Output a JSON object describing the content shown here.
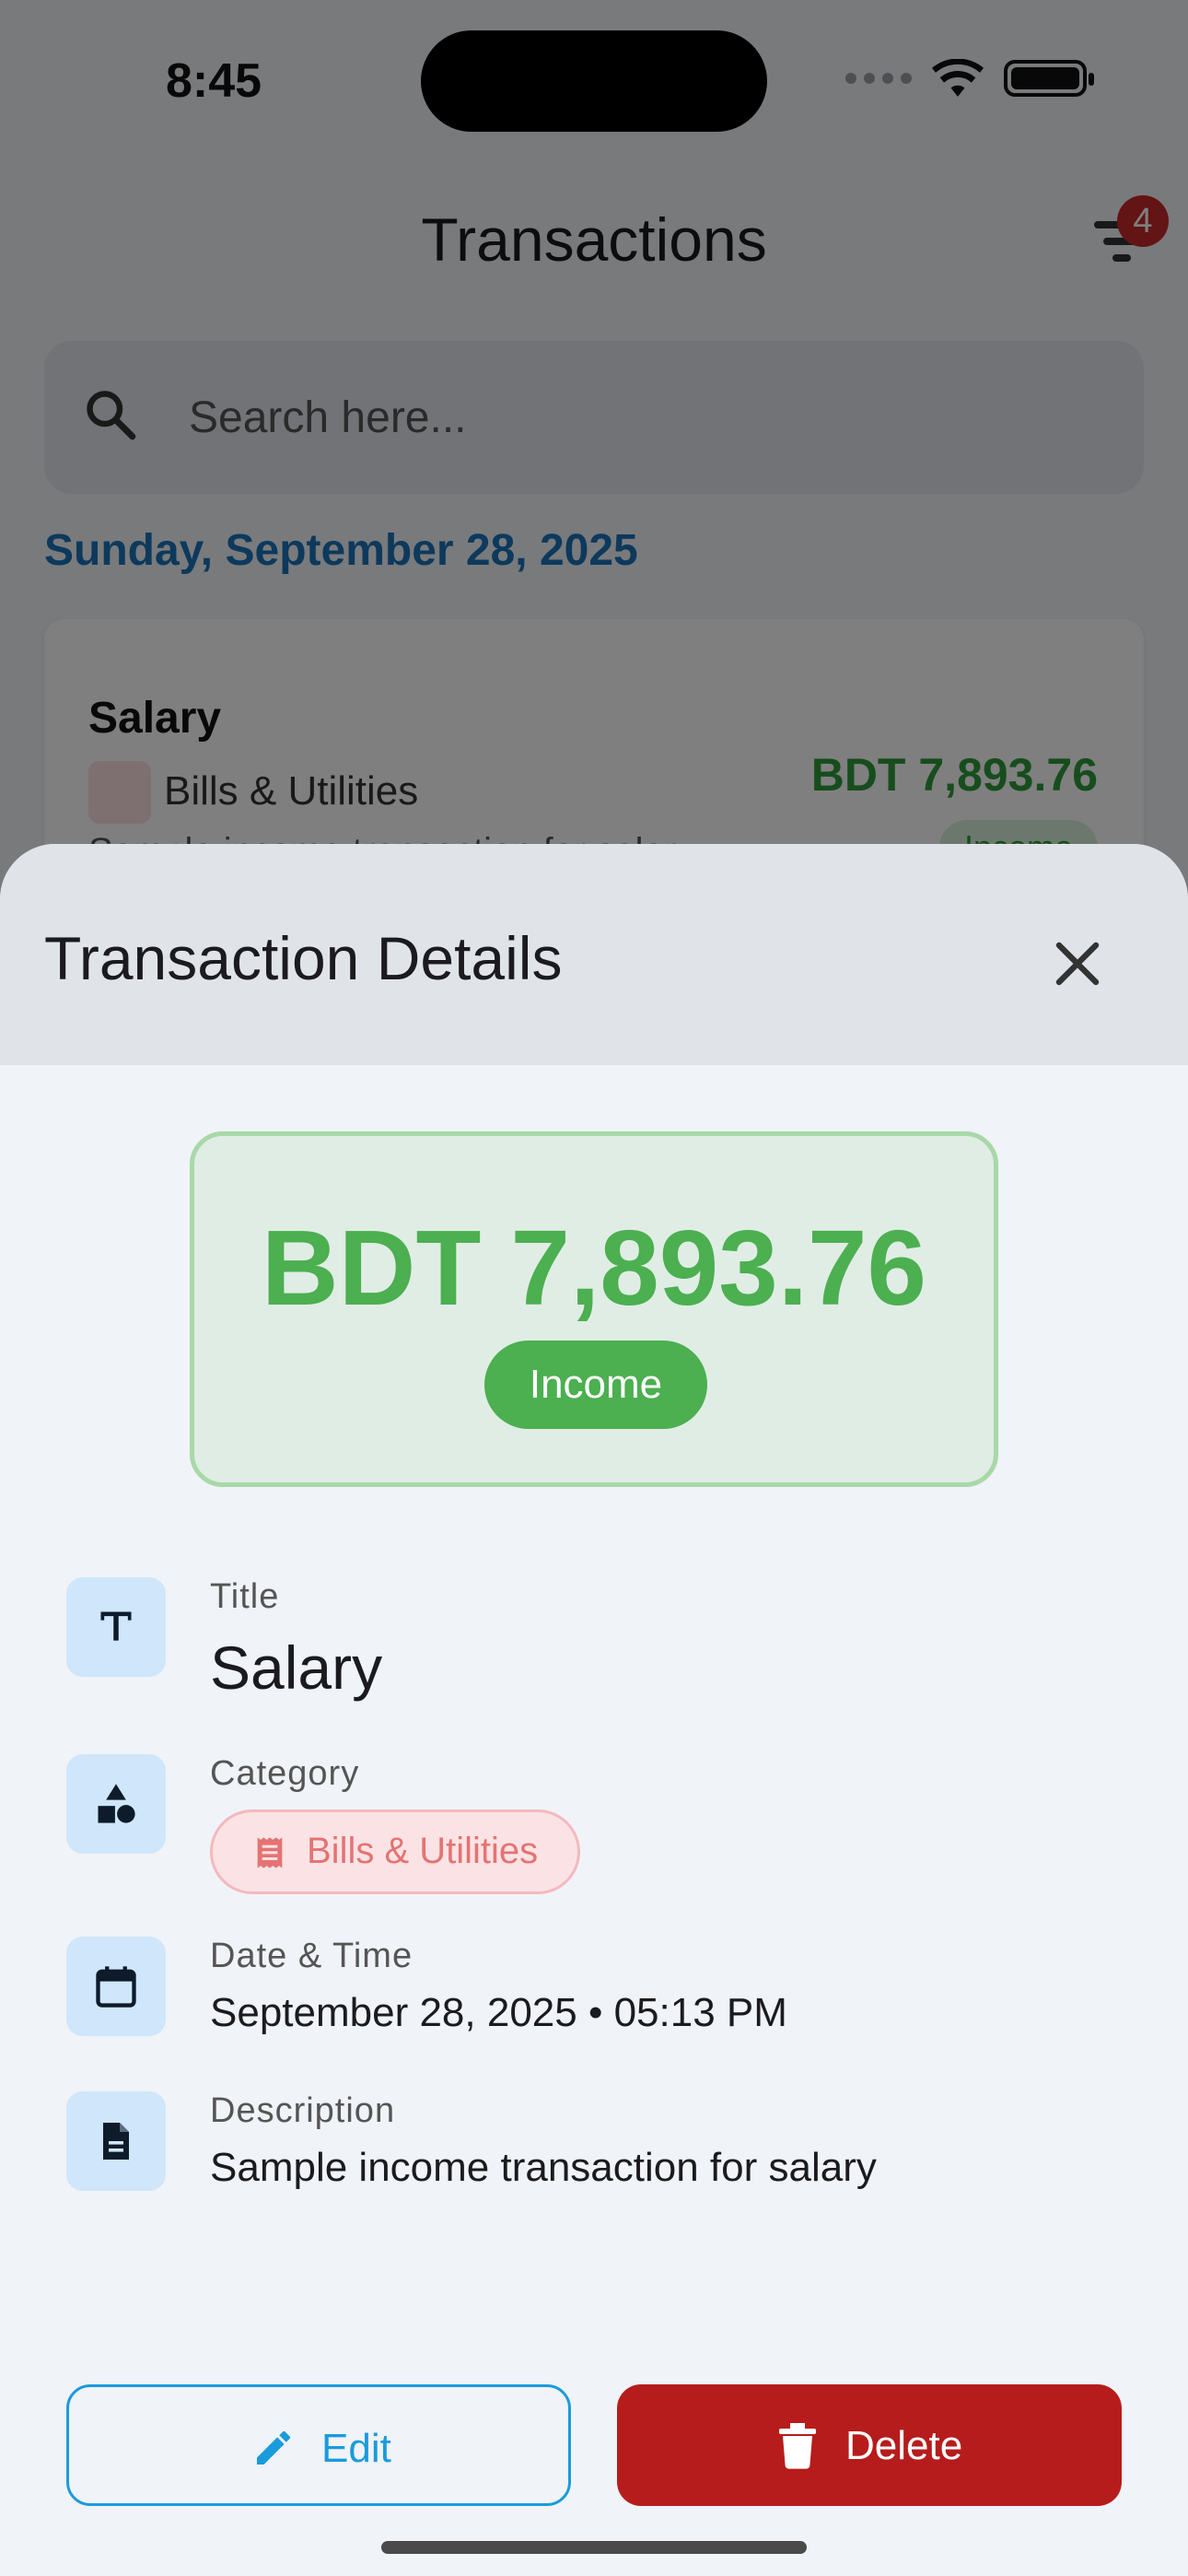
{
  "status_bar": {
    "time": "8:45"
  },
  "header": {
    "title": "Transactions",
    "filter_badge": "4"
  },
  "search": {
    "placeholder": "Search here..."
  },
  "list": {
    "date": "Sunday, September 28, 2025",
    "transaction": {
      "title": "Salary",
      "category": "Bills & Utilities",
      "amount": "BDT 7,893.76",
      "description": "Sample income transaction for salary",
      "type": "Income"
    }
  },
  "sheet": {
    "title": "Transaction Details",
    "amount": "BDT 7,893.76",
    "type": "Income",
    "fields": {
      "title_label": "Title",
      "title_value": "Salary",
      "category_label": "Category",
      "category_value": "Bills & Utilities",
      "datetime_label": "Date & Time",
      "datetime_value": "September 28, 2025 • 05:13 PM",
      "description_label": "Description",
      "description_value": "Sample income transaction for salary"
    },
    "actions": {
      "edit": "Edit",
      "delete": "Delete"
    }
  },
  "colors": {
    "income": "#4caf50",
    "accent": "#1a9bdc",
    "danger": "#b71c1c",
    "category": "#e57373"
  }
}
